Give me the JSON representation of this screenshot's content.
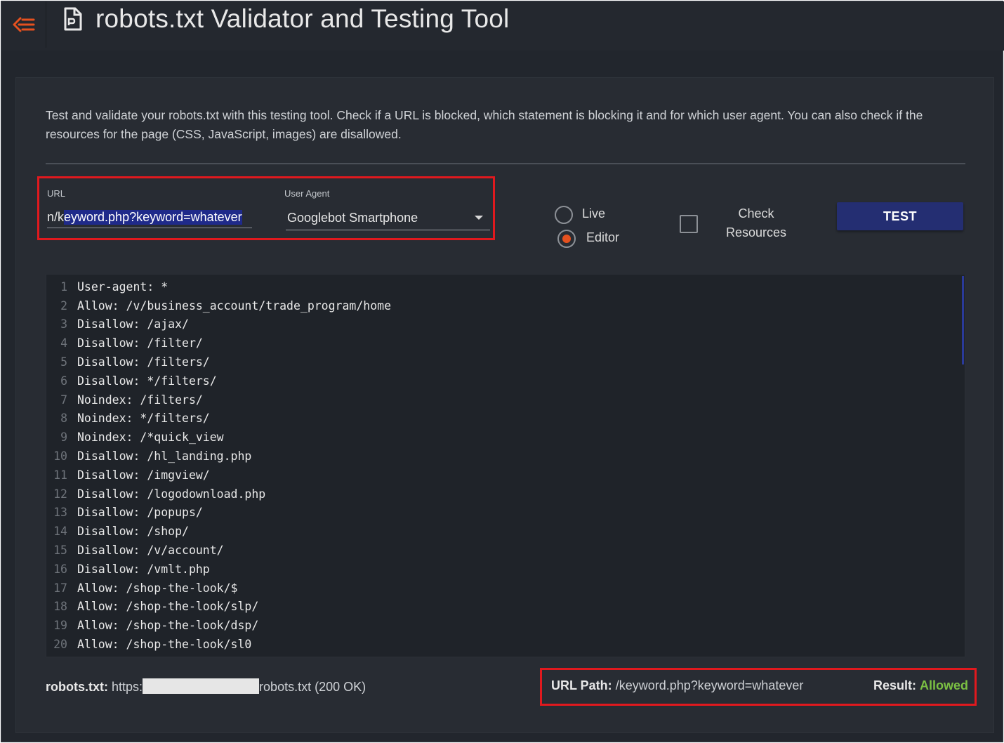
{
  "header": {
    "menu_icon": "back-menu-icon",
    "title_icon": "document-icon",
    "title": "robots.txt Validator and Testing Tool"
  },
  "intro": "Test and validate your robots.txt with this testing tool. Check if a URL is blocked, which statement is blocking it and for which user agent. You can also check if the resources for the page (CSS, JavaScript, images) are disallowed.",
  "form": {
    "url_label": "URL",
    "url_value_prefix": "n/k",
    "url_value_selected": "eyword.php?keyword=whatever",
    "user_agent_label": "User Agent",
    "user_agent_value": "Googlebot Smartphone",
    "mode_live": "Live",
    "mode_editor": "Editor",
    "selected_mode": "Editor",
    "check_resources_line1": "Check",
    "check_resources_line2": "Resources",
    "check_resources_checked": false,
    "test_label": "TEST"
  },
  "editor": {
    "lines": [
      "User-agent: *",
      "Allow: /v/business_account/trade_program/home",
      "Disallow: /ajax/",
      "Disallow: /filter/",
      "Disallow: /filters/",
      "Disallow: */filters/",
      "Noindex: /filters/",
      "Noindex: */filters/",
      "Noindex: /*quick_view",
      "Disallow: /hl_landing.php",
      "Disallow: /imgview/",
      "Disallow: /logodownload.php",
      "Disallow: /popups/",
      "Disallow: /shop/",
      "Disallow: /v/account/",
      "Disallow: /vmlt.php",
      "Allow: /shop-the-look/$",
      "Allow: /shop-the-look/slp/",
      "Allow: /shop-the-look/dsp/",
      "Allow: /shop-the-look/sl0"
    ]
  },
  "footer": {
    "robots_label": "robots.txt:",
    "robots_prefix": "https:",
    "robots_suffix": "robots.txt (200 OK)",
    "url_path_label": "URL Path:",
    "url_path_value": "/keyword.php?keyword=whatever",
    "result_label": "Result:",
    "result_value": "Allowed"
  },
  "colors": {
    "accent": "#e5511f",
    "button": "#242e72",
    "highlight_box": "#e0191e",
    "allowed": "#7bc043"
  }
}
